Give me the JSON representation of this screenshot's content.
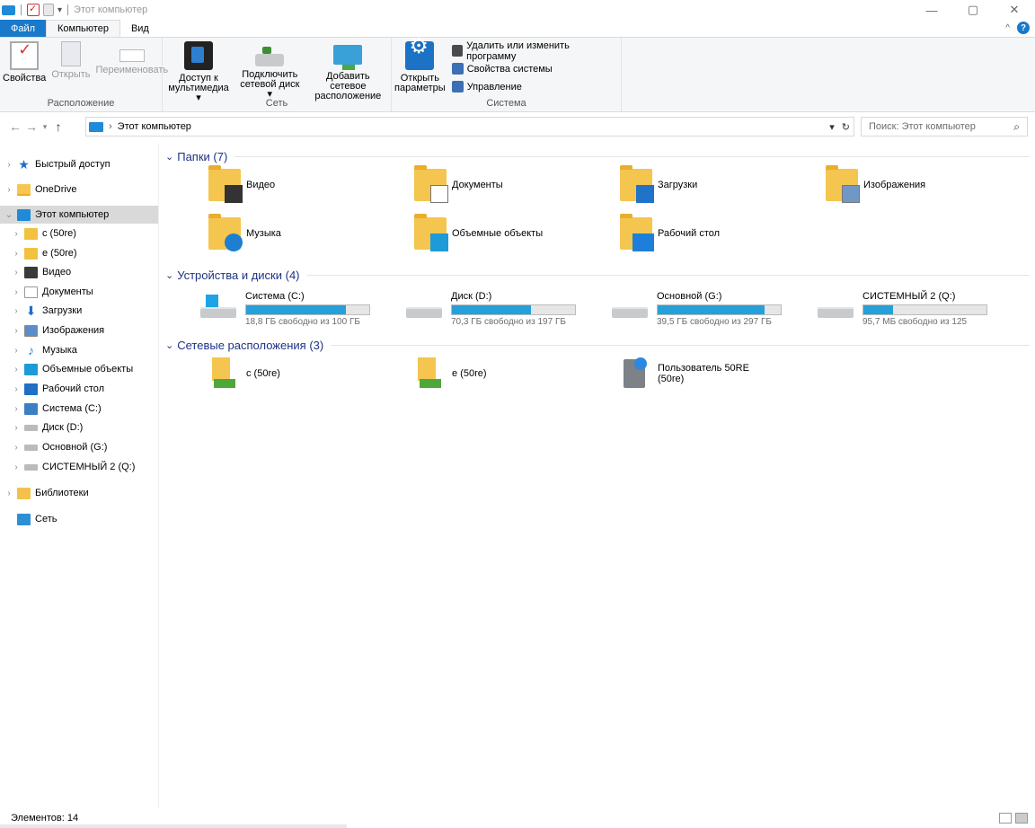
{
  "window": {
    "title": "Этот компьютер",
    "controls": [
      "—",
      "▢",
      "✕"
    ]
  },
  "ribbon_tabs": [
    {
      "label": "Файл"
    },
    {
      "label": "Компьютер"
    },
    {
      "label": "Вид"
    }
  ],
  "ribbon": {
    "groups": [
      {
        "label": "Расположение",
        "buttons": [
          "Свойства",
          "Открыть",
          "Переименовать"
        ]
      },
      {
        "label": "Сеть",
        "buttons": [
          [
            "Доступ к",
            "мультимедиа ▾"
          ],
          [
            "Подключить",
            "сетевой диск ▾"
          ],
          [
            "Добавить сетевое",
            "расположение"
          ]
        ]
      },
      {
        "label": "Система",
        "buttons": [
          [
            "Открыть",
            "параметры"
          ]
        ],
        "items": [
          "Удалить или изменить программу",
          "Свойства системы",
          "Управление"
        ]
      }
    ]
  },
  "address": {
    "path": "Этот компьютер",
    "separator": "›"
  },
  "search": {
    "placeholder": "Поиск: Этот компьютер"
  },
  "sidebar": {
    "items": [
      {
        "label": "Быстрый доступ"
      },
      {
        "label": "OneDrive"
      },
      {
        "label": "Этот компьютер"
      },
      {
        "label": "c (50re)"
      },
      {
        "label": "e (50re)"
      },
      {
        "label": "Видео"
      },
      {
        "label": "Документы"
      },
      {
        "label": "Загрузки"
      },
      {
        "label": "Изображения"
      },
      {
        "label": "Музыка"
      },
      {
        "label": "Объемные объекты"
      },
      {
        "label": "Рабочий стол"
      },
      {
        "label": "Система (C:)"
      },
      {
        "label": "Диск (D:)"
      },
      {
        "label": "Основной (G:)"
      },
      {
        "label": "СИСТЕМНЫЙ 2 (Q:)"
      },
      {
        "label": "Библиотеки"
      },
      {
        "label": "Сеть"
      }
    ]
  },
  "main": {
    "folders_header": "Папки (7)",
    "folders": [
      {
        "label": "Видео"
      },
      {
        "label": "Документы"
      },
      {
        "label": "Загрузки"
      },
      {
        "label": "Изображения"
      },
      {
        "label": "Музыка"
      },
      {
        "label": "Объемные объекты"
      },
      {
        "label": "Рабочий стол"
      }
    ],
    "drives_header": "Устройства и диски (4)",
    "drives": [
      {
        "name": "Система (C:)",
        "free": "18,8 ГБ свободно из 100 ГБ",
        "used_fraction": 0.81
      },
      {
        "name": "Диск (D:)",
        "free": "70,3 ГБ свободно из 197 ГБ",
        "used_fraction": 0.64
      },
      {
        "name": "Основной (G:)",
        "free": "39,5 ГБ свободно из 297 ГБ",
        "used_fraction": 0.87
      },
      {
        "name": "СИСТЕМНЫЙ 2 (Q:)",
        "free": "95,7 МБ свободно из 125",
        "used_fraction": 0.24
      }
    ],
    "network_header": "Сетевые расположения (3)",
    "network": [
      {
        "label": "c (50re)"
      },
      {
        "label": "e (50re)"
      },
      {
        "label": "Пользователь 50RE (50re)"
      }
    ]
  },
  "status": {
    "items_text": "Элементов: 14"
  },
  "colors": {
    "accent": "#1979ca",
    "group_header": "#1e3287",
    "bar_fill": "#26a0da",
    "selection": "#d9d9d9"
  }
}
